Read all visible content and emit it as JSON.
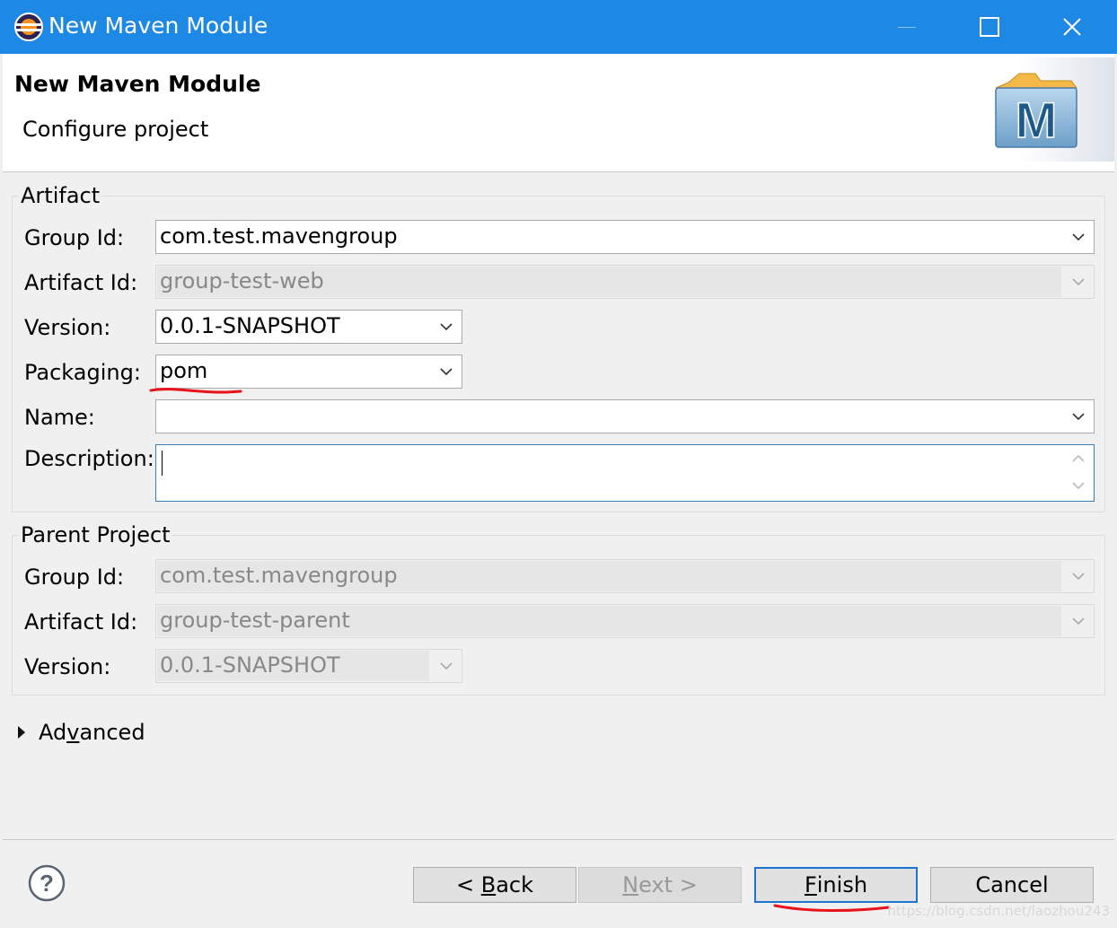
{
  "window": {
    "title": "New Maven Module",
    "minimize_glyph": "—",
    "maximize_glyph": "☐",
    "close_glyph": "✕"
  },
  "header": {
    "title": "New Maven Module",
    "subtitle": "Configure project",
    "logo_letter": "M"
  },
  "artifact": {
    "label": "Artifact",
    "group_id_label": "Group Id:",
    "group_id": "com.test.mavengroup",
    "artifact_id_label": "Artifact Id:",
    "artifact_id": "group-test-web",
    "version_label": "Version:",
    "version": "0.0.1-SNAPSHOT",
    "packaging_label": "Packaging:",
    "packaging": "pom",
    "name_label": "Name:",
    "name": "",
    "description_label": "Description:",
    "description": ""
  },
  "parent": {
    "label": "Parent Project",
    "group_id_label": "Group Id:",
    "group_id": "com.test.mavengroup",
    "artifact_id_label": "Artifact Id:",
    "artifact_id": "group-test-parent",
    "version_label": "Version:",
    "version": "0.0.1-SNAPSHOT"
  },
  "advanced": {
    "pre": "Ad",
    "mnemonic": "v",
    "post": "anced"
  },
  "buttons": {
    "back": {
      "pre": "< ",
      "mnemonic": "B",
      "post": "ack"
    },
    "next": {
      "pre": "",
      "mnemonic": "N",
      "post": "ext >"
    },
    "finish": {
      "pre": "",
      "mnemonic": "F",
      "post": "inish"
    },
    "cancel": "Cancel",
    "help_glyph": "?"
  },
  "watermark": "https://blog.csdn.net/laozhou243",
  "colors": {
    "titlebar": "#1e88e5",
    "annotation": "#e8141a",
    "focus_border": "#1e74d2"
  },
  "icons": [
    "eclipse-icon",
    "minimize-icon",
    "maximize-icon",
    "close-icon",
    "maven-logo",
    "chevron-down-icon",
    "triangle-right-icon",
    "help-icon"
  ]
}
